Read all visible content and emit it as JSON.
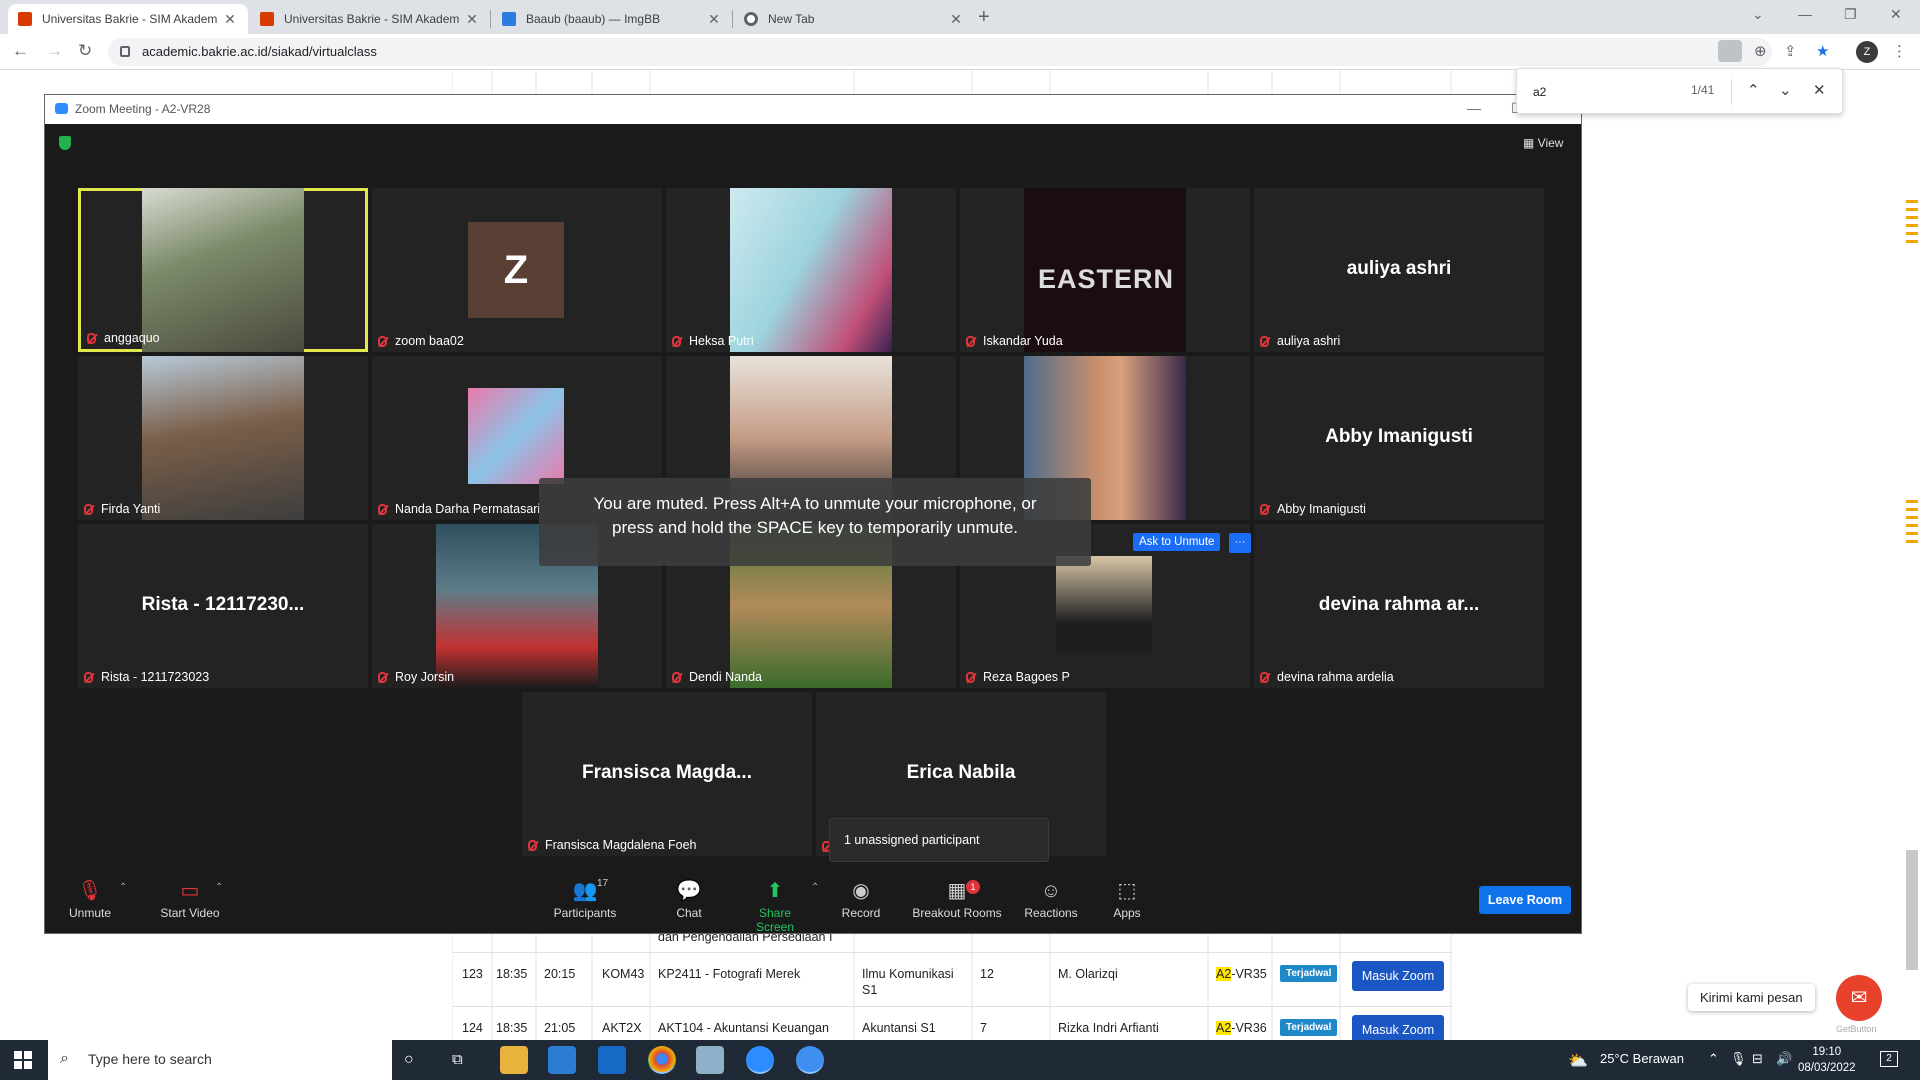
{
  "browser": {
    "tabs": [
      {
        "title": "Universitas Bakrie - SIM Akadem",
        "active": true
      },
      {
        "title": "Universitas Bakrie - SIM Akadem",
        "active": false
      },
      {
        "title": "Baaub (baaub) — ImgBB",
        "active": false
      },
      {
        "title": "New Tab",
        "active": false
      }
    ],
    "url": "academic.bakrie.ac.id/siakad/virtualclass",
    "profile_initial": "Z",
    "find": {
      "query": "a2",
      "count": "1/41"
    }
  },
  "zoom": {
    "window_title": "Zoom Meeting - A2-VR28",
    "view_label": "View",
    "participants": [
      {
        "name": "anggaquo",
        "display": "photo",
        "active": true
      },
      {
        "name": "zoom baa02",
        "display": "avatar",
        "initial": "Z"
      },
      {
        "name": "Heksa Putri",
        "display": "photo"
      },
      {
        "name": "Iskandar Yuda",
        "display": "photo",
        "image_text": "EASTERN"
      },
      {
        "name": "auliya ashri",
        "display": "name",
        "big": "auliya ashri"
      },
      {
        "name": "Firda Yanti",
        "display": "photo"
      },
      {
        "name": "Nanda Darha Permatasari",
        "display": "photo"
      },
      {
        "name": "",
        "display": "photo"
      },
      {
        "name": "",
        "display": "photo"
      },
      {
        "name": "Abby Imanigusti",
        "display": "name",
        "big": "Abby Imanigusti"
      },
      {
        "name": "Rista - 1211723023",
        "display": "name",
        "big": "Rista - 12117230..."
      },
      {
        "name": "Roy Jorsin",
        "display": "photo"
      },
      {
        "name": "Dendi Nanda",
        "display": "photo"
      },
      {
        "name": "Reza Bagoes P",
        "display": "photo"
      },
      {
        "name": "devina rahma ardelia",
        "display": "name",
        "big": "devina rahma ar..."
      },
      {
        "name": "Fransisca Magdalena Foeh",
        "display": "name",
        "big": "Fransisca Magda..."
      },
      {
        "name": "",
        "display": "name",
        "big": "Erica Nabila"
      }
    ],
    "muted_banner_line1": "You are muted. Press Alt+A to unmute your microphone, or",
    "muted_banner_line2": "press and hold the SPACE key to temporarily unmute.",
    "ask_to_unmute": "Ask to Unmute",
    "more": "···",
    "unassigned": "1 unassigned participant",
    "controls": {
      "unmute": "Unmute",
      "start_video": "Start Video",
      "participants": "Participants",
      "participants_count": "17",
      "chat": "Chat",
      "share_screen": "Share Screen",
      "record": "Record",
      "breakout_rooms": "Breakout Rooms",
      "breakout_badge": "1",
      "reactions": "Reactions",
      "apps": "Apps",
      "leave_room": "Leave Room"
    }
  },
  "page": {
    "partial_text": "dan Pengendalian Persediaan I",
    "rows": [
      {
        "no": "123",
        "start": "18:35",
        "end": "20:15",
        "code": "KOM43",
        "course": "KP2411 - Fotografi Merek",
        "program_l1": "Ilmu Komunikasi",
        "program_l2": "S1",
        "count": "12",
        "lecturer": "M. Olarizqi",
        "room_hl": "A2",
        "room_rest": "-VR35",
        "status": "Terjadwal",
        "action": "Masuk Zoom"
      },
      {
        "no": "124",
        "start": "18:35",
        "end": "21:05",
        "code": "AKT2X",
        "course": "AKT104 - Akuntansi Keuangan",
        "program_l1": "Akuntansi S1",
        "program_l2": "",
        "count": "7",
        "lecturer": "Rizka Indri Arfianti",
        "room_hl": "A2",
        "room_rest": "-VR36",
        "status": "Terjadwal",
        "action": "Masuk Zoom"
      }
    ],
    "chat_tip": "Kirimi kami pesan",
    "getbutton": "GetButton"
  },
  "taskbar": {
    "search_placeholder": "Type here to search",
    "weather": "25°C  Berawan",
    "time": "19:10",
    "date": "08/03/2022",
    "notif_count": "2"
  }
}
